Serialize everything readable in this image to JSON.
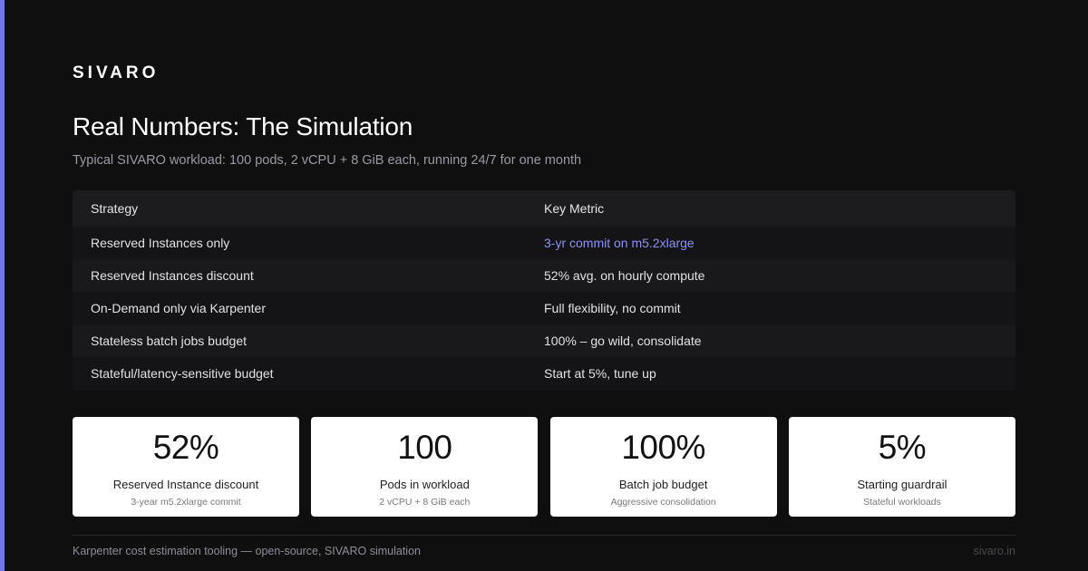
{
  "brand": {
    "logo": "SIVARO",
    "accent_color": "#6f78e8",
    "highlight_color": "#8c92f5"
  },
  "header": {
    "title": "Real Numbers: The Simulation",
    "subtitle": "Typical SIVARO workload: 100 pods, 2 vCPU + 8 GiB each, running 24/7 for one month"
  },
  "table": {
    "columns": [
      "Strategy",
      "Key Metric"
    ],
    "rows": [
      {
        "strategy": "Reserved Instances only",
        "metric": "3-yr commit on m5.2xlarge"
      },
      {
        "strategy": "Reserved Instances discount",
        "metric": "52% avg. on hourly compute"
      },
      {
        "strategy": "On-Demand only via Karpenter",
        "metric": "Full flexibility, no commit"
      },
      {
        "strategy": "Stateless batch jobs budget",
        "metric": "100% – go wild, consolidate"
      },
      {
        "strategy": "Stateful/latency-sensitive budget",
        "metric": "Start at 5%, tune up"
      }
    ]
  },
  "cards": [
    {
      "value": "52%",
      "label": "Reserved Instance discount",
      "sub": "3-year m5.2xlarge commit"
    },
    {
      "value": "100",
      "label": "Pods in workload",
      "sub": "2 vCPU + 8 GiB each"
    },
    {
      "value": "100%",
      "label": "Batch job budget",
      "sub": "Aggressive consolidation"
    },
    {
      "value": "5%",
      "label": "Starting guardrail",
      "sub": "Stateful workloads"
    }
  ],
  "footer": {
    "left": "Karpenter cost estimation tooling — open-source, SIVARO simulation",
    "right": "sivaro.in"
  }
}
